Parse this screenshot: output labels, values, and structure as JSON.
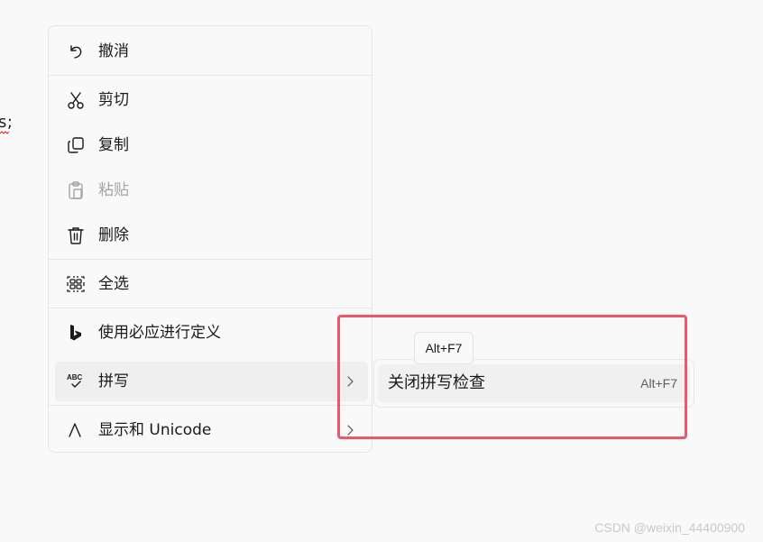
{
  "background": {
    "text_fragment": "s;"
  },
  "context_menu": {
    "items": [
      {
        "label": "撤消",
        "icon": "undo-icon",
        "enabled": true
      },
      {
        "label": "剪切",
        "icon": "cut-icon",
        "enabled": true
      },
      {
        "label": "复制",
        "icon": "copy-icon",
        "enabled": true
      },
      {
        "label": "粘贴",
        "icon": "paste-icon",
        "enabled": false
      },
      {
        "label": "删除",
        "icon": "trash-icon",
        "enabled": true
      },
      {
        "label": "全选",
        "icon": "select-all-icon",
        "enabled": true
      },
      {
        "label": "使用必应进行定义",
        "icon": "bing-icon",
        "enabled": true
      },
      {
        "label": "拼写",
        "icon": "spelling-icon",
        "enabled": true,
        "has_submenu": true,
        "active": true
      },
      {
        "label": "显示和 Unicode",
        "icon": "unicode-icon",
        "enabled": true,
        "has_submenu": true
      }
    ]
  },
  "spelling_submenu": {
    "items": [
      {
        "label": "关闭拼写检查",
        "shortcut": "Alt+F7"
      }
    ]
  },
  "tooltip": {
    "text": "Alt+F7"
  },
  "watermark": {
    "text": "CSDN @weixin_44400900"
  },
  "colors": {
    "highlight_border": "#f0556e",
    "menu_background": "#f9f9f9",
    "hover_background": "#efefef",
    "disabled_text": "#a5a5a5"
  }
}
